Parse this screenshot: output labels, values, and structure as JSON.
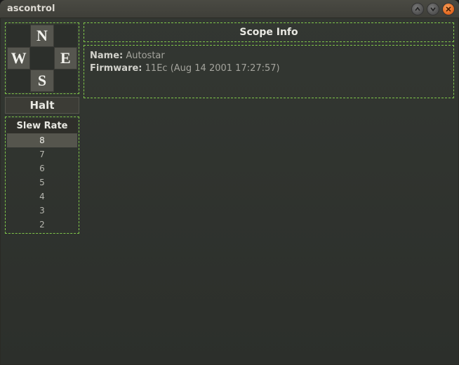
{
  "window": {
    "title": "ascontrol"
  },
  "dpad": {
    "north": "N",
    "south": "S",
    "east": "E",
    "west": "W"
  },
  "halt": {
    "label": "Halt"
  },
  "slew": {
    "header": "Slew Rate",
    "rates": [
      "8",
      "7",
      "6",
      "5",
      "4",
      "3",
      "2"
    ],
    "selected": "8"
  },
  "scope": {
    "header": "Scope Info",
    "name_label": "Name:",
    "name_value": "Autostar",
    "firmware_label": "Firmware:",
    "firmware_value": "11Ec (Aug 14 2001 17:27:57)"
  }
}
